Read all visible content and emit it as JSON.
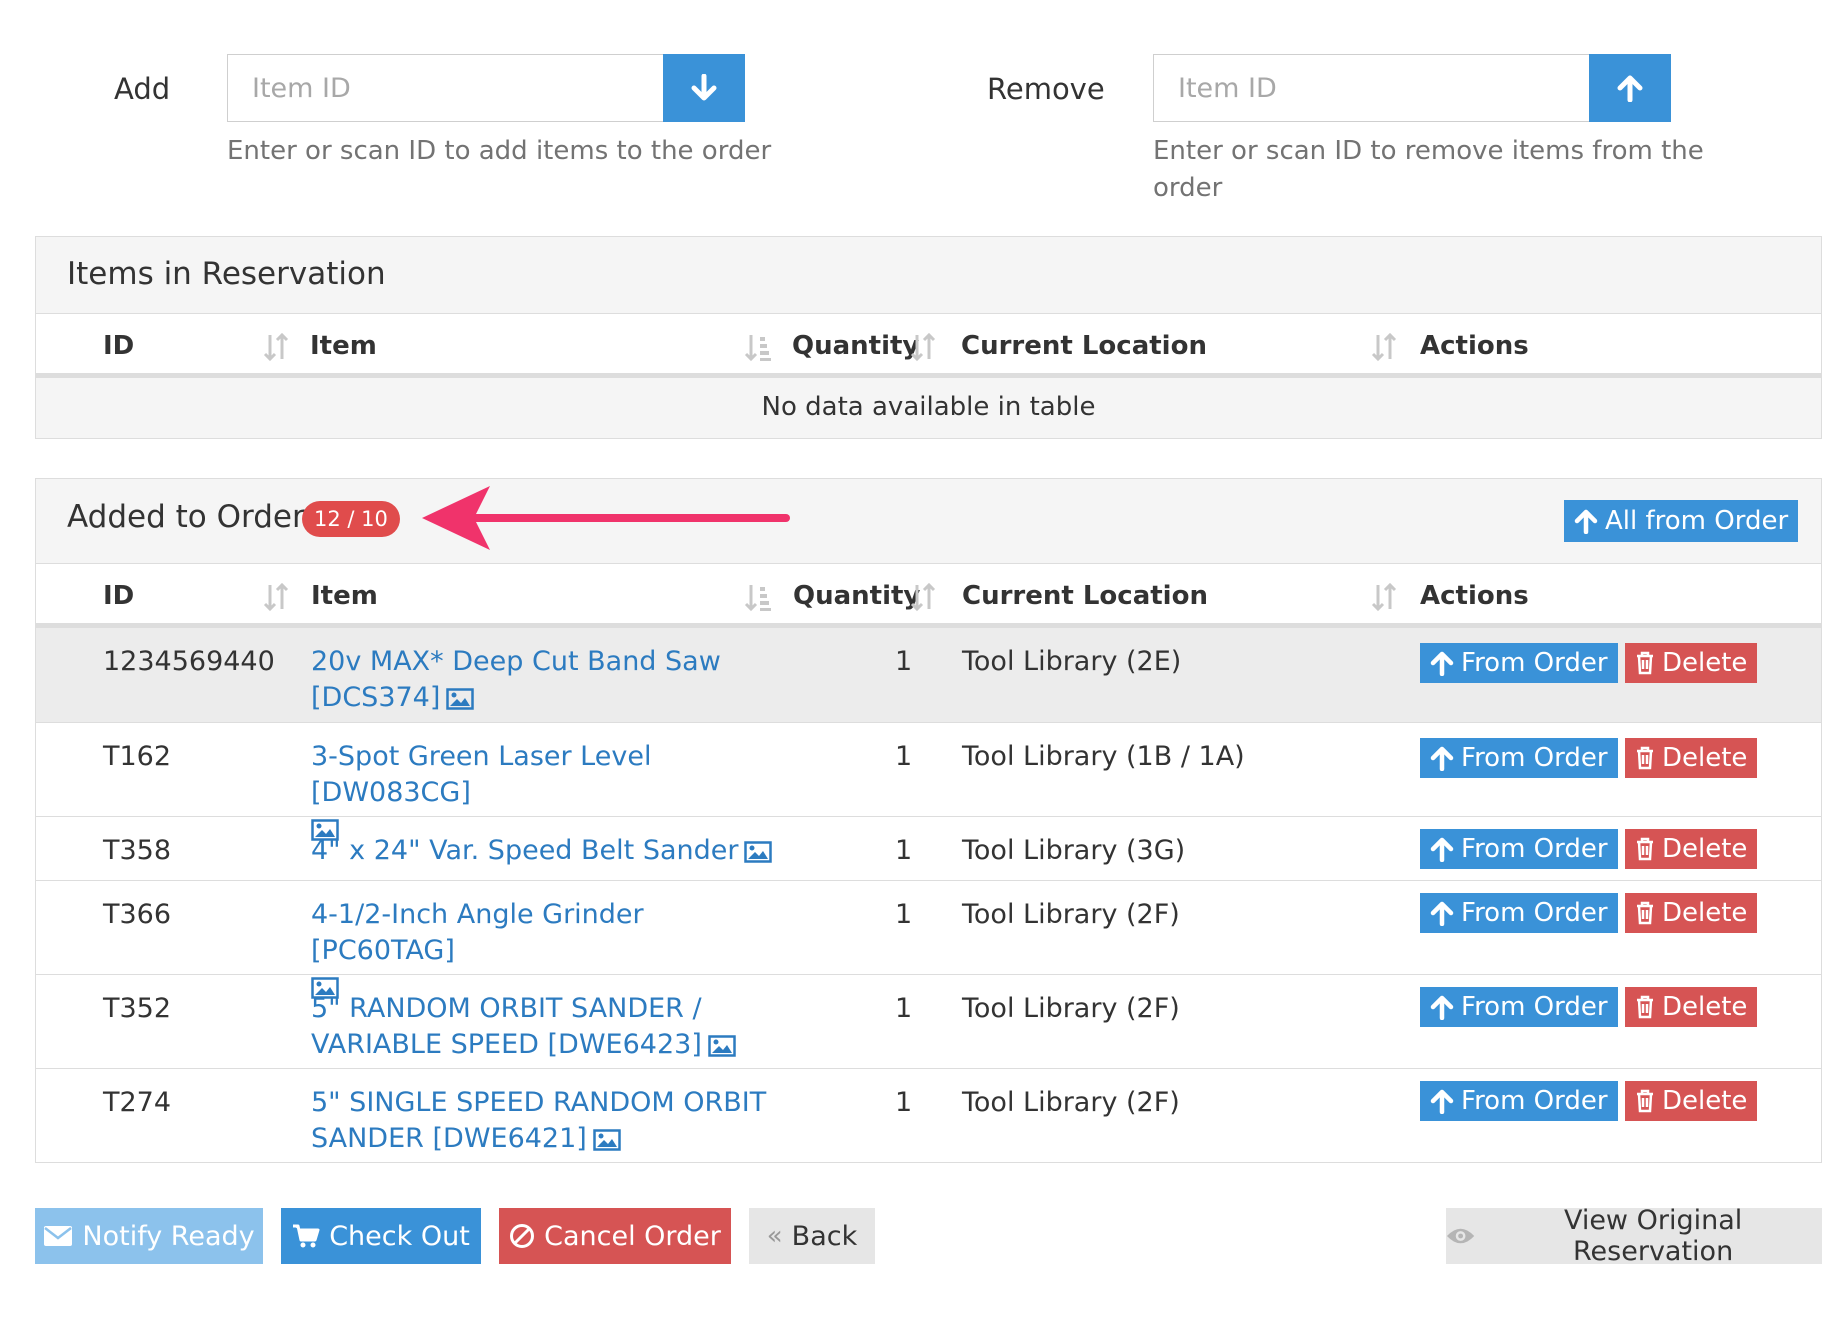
{
  "add": {
    "label": "Add",
    "placeholder": "Item ID",
    "help": "Enter or scan ID to add items to the order"
  },
  "remove": {
    "label": "Remove",
    "placeholder": "Item ID",
    "help_line1": "Enter or scan ID to remove items from the",
    "help_line2": "order"
  },
  "reservation": {
    "title": "Items in Reservation",
    "columns": [
      "ID",
      "Item",
      "Quantity",
      "Current Location",
      "Actions"
    ],
    "empty_text": "No data available in table"
  },
  "order": {
    "title": "Added to Order",
    "badge": "12 / 10",
    "all_from_order_label": "All from Order",
    "columns": [
      "ID",
      "Item",
      "Quantity",
      "Current Location",
      "Actions"
    ],
    "rows": [
      {
        "id": "1234569440",
        "item_line1": "20v MAX* Deep Cut Band Saw",
        "item_line2": "[DCS374]",
        "qty": "1",
        "location": "Tool Library (2E)"
      },
      {
        "id": "T162",
        "item_line1": "3-Spot Green Laser Level [DW083CG]",
        "item_line2": "",
        "qty": "1",
        "location": "Tool Library (1B / 1A)"
      },
      {
        "id": "T358",
        "item_line1": "4\" x 24\" Var. Speed Belt Sander",
        "item_line2": "",
        "qty": "1",
        "location": "Tool Library (3G)"
      },
      {
        "id": "T366",
        "item_line1": "4-1/2-Inch Angle Grinder [PC60TAG]",
        "item_line2": "",
        "qty": "1",
        "location": "Tool Library (2F)"
      },
      {
        "id": "T352",
        "item_line1": "5\" RANDOM ORBIT SANDER /",
        "item_line2": "VARIABLE SPEED [DWE6423]",
        "qty": "1",
        "location": "Tool Library (2F)"
      },
      {
        "id": "T274",
        "item_line1": "5\" SINGLE SPEED RANDOM ORBIT",
        "item_line2": "SANDER [DWE6421]",
        "qty": "1",
        "location": "Tool Library (2F)"
      }
    ],
    "from_order_label": "From Order",
    "delete_label": "Delete"
  },
  "footer": {
    "notify_ready": "Notify Ready",
    "check_out": "Check Out",
    "cancel_order": "Cancel Order",
    "back": "Back",
    "view_original": "View Original Reservation"
  },
  "colors": {
    "primary": "#3a92d8",
    "danger": "#d65454",
    "badge": "#e04c4c",
    "link": "#2c7bc0",
    "annotation_arrow": "#f0336b"
  }
}
